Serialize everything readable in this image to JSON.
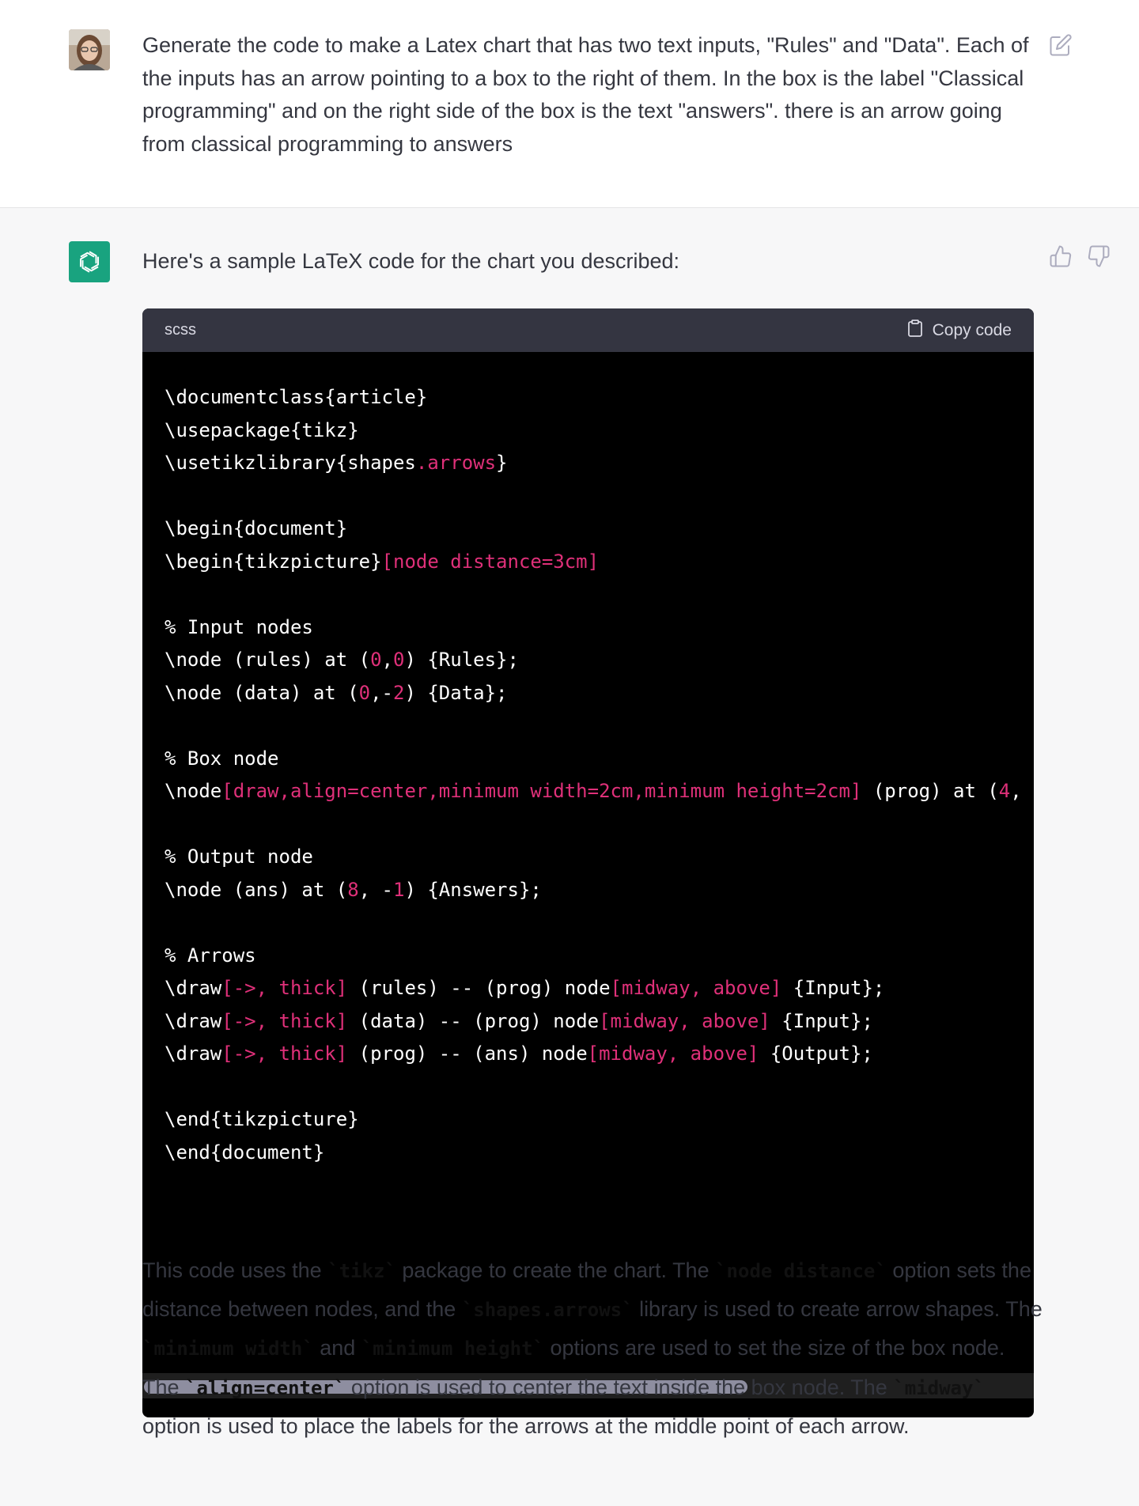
{
  "user": {
    "avatar_name": "user-avatar",
    "message": "Generate the code to make a Latex chart that has two text inputs, \"Rules\" and \"Data\". Each of the inputs has an arrow pointing to a box to the right of them. In the box is the label \"Classical programming\" and on the right side of the box is the text \"answers\". there is an arrow going from classical programming to answers"
  },
  "assistant": {
    "intro": "Here's a sample LaTeX code for the chart you described:",
    "code_block": {
      "language": "scss",
      "copy_label": "Copy code",
      "lines": [
        [
          {
            "t": "\\documentclass{article}",
            "c": "w"
          }
        ],
        [
          {
            "t": "\\usepackage{tikz}",
            "c": "w"
          }
        ],
        [
          {
            "t": "\\usetikzlibrary{shapes",
            "c": "w"
          },
          {
            "t": ".arrows",
            "c": "p"
          },
          {
            "t": "}",
            "c": "w"
          }
        ],
        [],
        [
          {
            "t": "\\begin{document}",
            "c": "w"
          }
        ],
        [
          {
            "t": "\\begin{tikzpicture}",
            "c": "w"
          },
          {
            "t": "[node distance=3cm]",
            "c": "p"
          }
        ],
        [],
        [
          {
            "t": "% Input nodes",
            "c": "w"
          }
        ],
        [
          {
            "t": "\\node (rules) at (",
            "c": "w"
          },
          {
            "t": "0",
            "c": "p"
          },
          {
            "t": ",",
            "c": "w"
          },
          {
            "t": "0",
            "c": "p"
          },
          {
            "t": ") {Rules};",
            "c": "w"
          }
        ],
        [
          {
            "t": "\\node (data) at (",
            "c": "w"
          },
          {
            "t": "0",
            "c": "p"
          },
          {
            "t": ",-",
            "c": "w"
          },
          {
            "t": "2",
            "c": "p"
          },
          {
            "t": ") {Data};",
            "c": "w"
          }
        ],
        [],
        [
          {
            "t": "% Box node",
            "c": "w"
          }
        ],
        [
          {
            "t": "\\node",
            "c": "w"
          },
          {
            "t": "[draw,align=center,minimum width=2cm,minimum height=2cm]",
            "c": "p"
          },
          {
            "t": " (prog) at (",
            "c": "w"
          },
          {
            "t": "4",
            "c": "p"
          },
          {
            "t": ",",
            "c": "w"
          }
        ],
        [],
        [
          {
            "t": "% Output node",
            "c": "w"
          }
        ],
        [
          {
            "t": "\\node (ans) at (",
            "c": "w"
          },
          {
            "t": "8",
            "c": "p"
          },
          {
            "t": ", -",
            "c": "w"
          },
          {
            "t": "1",
            "c": "p"
          },
          {
            "t": ") {Answers};",
            "c": "w"
          }
        ],
        [],
        [
          {
            "t": "% Arrows",
            "c": "w"
          }
        ],
        [
          {
            "t": "\\draw",
            "c": "w"
          },
          {
            "t": "[->, thick]",
            "c": "p"
          },
          {
            "t": " (rules) -- (prog) node",
            "c": "w"
          },
          {
            "t": "[midway, above]",
            "c": "p"
          },
          {
            "t": " {Input};",
            "c": "w"
          }
        ],
        [
          {
            "t": "\\draw",
            "c": "w"
          },
          {
            "t": "[->, thick]",
            "c": "p"
          },
          {
            "t": " (data) -- (prog) node",
            "c": "w"
          },
          {
            "t": "[midway, above]",
            "c": "p"
          },
          {
            "t": " {Input};",
            "c": "w"
          }
        ],
        [
          {
            "t": "\\draw",
            "c": "w"
          },
          {
            "t": "[->, thick]",
            "c": "p"
          },
          {
            "t": " (prog) -- (ans) node",
            "c": "w"
          },
          {
            "t": "[midway, above]",
            "c": "p"
          },
          {
            "t": " {Output};",
            "c": "w"
          }
        ],
        [],
        [
          {
            "t": "\\end{tikzpicture}",
            "c": "w"
          }
        ],
        [
          {
            "t": "\\end{document}",
            "c": "w"
          }
        ]
      ]
    },
    "explanation": [
      {
        "t": "This code uses the "
      },
      {
        "t": "`tikz`",
        "code": true
      },
      {
        "t": " package to create the chart. The "
      },
      {
        "t": "`node distance`",
        "code": true
      },
      {
        "t": " option sets the distance between nodes, and the "
      },
      {
        "t": "`shapes.arrows`",
        "code": true
      },
      {
        "t": " library is used to create arrow shapes. The "
      },
      {
        "t": "`minimum width`",
        "code": true
      },
      {
        "t": " and "
      },
      {
        "t": "`minimum height`",
        "code": true
      },
      {
        "t": " options are used to set the size of the box node. The "
      },
      {
        "t": "`align=center`",
        "code": true
      },
      {
        "t": " option is used to center the text inside the box node. The "
      },
      {
        "t": "`midway`",
        "code": true
      },
      {
        "t": " option is used to place the labels for the arrows at the middle point of each arrow."
      }
    ]
  },
  "icons": {
    "edit": "edit-icon",
    "thumbs_up": "thumbs-up-icon",
    "thumbs_down": "thumbs-down-icon",
    "clipboard": "clipboard-icon",
    "openai_logo": "openai-logo-icon"
  },
  "colors": {
    "user_bg": "#ffffff",
    "assistant_bg": "#f7f7f8",
    "code_bg": "#000000",
    "code_header_bg": "#343541",
    "code_accent": "#df3079",
    "brand": "#19a37f"
  }
}
